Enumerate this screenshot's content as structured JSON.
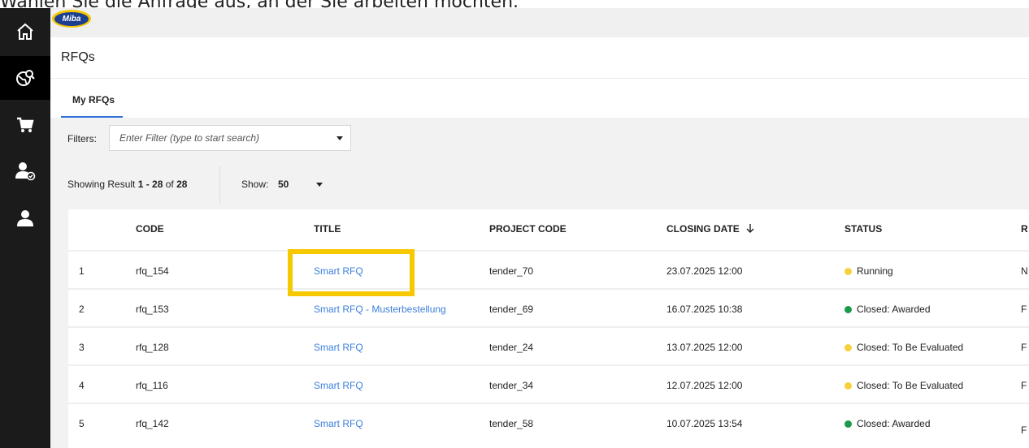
{
  "instruction": "Wählen Sie die Anfrage aus, an der Sie arbeiten möchten.",
  "brand": {
    "logo_text": "Miba",
    "accent": "#f5c400",
    "logo_blue": "#1d3f8f"
  },
  "sidebar": {
    "items": [
      {
        "name": "home-icon",
        "active": false
      },
      {
        "name": "globe-search-icon",
        "active": true
      },
      {
        "name": "cart-icon",
        "active": false
      },
      {
        "name": "user-check-icon",
        "active": false
      },
      {
        "name": "user-icon",
        "active": false
      }
    ]
  },
  "header": {
    "title": "RFQs"
  },
  "tabs": [
    {
      "label": "My RFQs",
      "active": true
    }
  ],
  "filters": {
    "label": "Filters:",
    "placeholder": "Enter Filter (type to start search)",
    "value": ""
  },
  "results": {
    "prefix": "Showing Result ",
    "range": "1 - 28",
    "of": " of ",
    "total": "28",
    "show_label": "Show:",
    "show_value": "50"
  },
  "table": {
    "columns": [
      "CODE",
      "TITLE",
      "PROJECT CODE",
      "CLOSING DATE",
      "STATUS",
      "R"
    ],
    "sort_icon": "arrow-down-icon",
    "rows": [
      {
        "index": "1",
        "code": "rfq_154",
        "title": "Smart RFQ",
        "project": "tender_70",
        "closing": "23.07.2025 12:00",
        "status": "Running",
        "status_color": "#f7d13c",
        "extra": "N"
      },
      {
        "index": "2",
        "code": "rfq_153",
        "title": "Smart RFQ - Musterbestellung",
        "project": "tender_69",
        "closing": "16.07.2025 10:38",
        "status": "Closed: Awarded",
        "status_color": "#1a9a4a",
        "extra": "F"
      },
      {
        "index": "3",
        "code": "rfq_128",
        "title": "Smart RFQ",
        "project": "tender_24",
        "closing": "13.07.2025 12:00",
        "status": "Closed: To Be Evaluated",
        "status_color": "#f7d13c",
        "extra": "F"
      },
      {
        "index": "4",
        "code": "rfq_116",
        "title": "Smart RFQ",
        "project": "tender_34",
        "closing": "12.07.2025 12:00",
        "status": "Closed: To Be Evaluated",
        "status_color": "#f7d13c",
        "extra": "F"
      },
      {
        "index": "5",
        "code": "rfq_142",
        "title": "Smart RFQ",
        "project": "tender_58",
        "closing": "10.07.2025 13:54",
        "status": "Closed: Awarded",
        "status_color": "#1a9a4a",
        "extra": "F"
      }
    ]
  },
  "highlight_color": "#f5c800"
}
